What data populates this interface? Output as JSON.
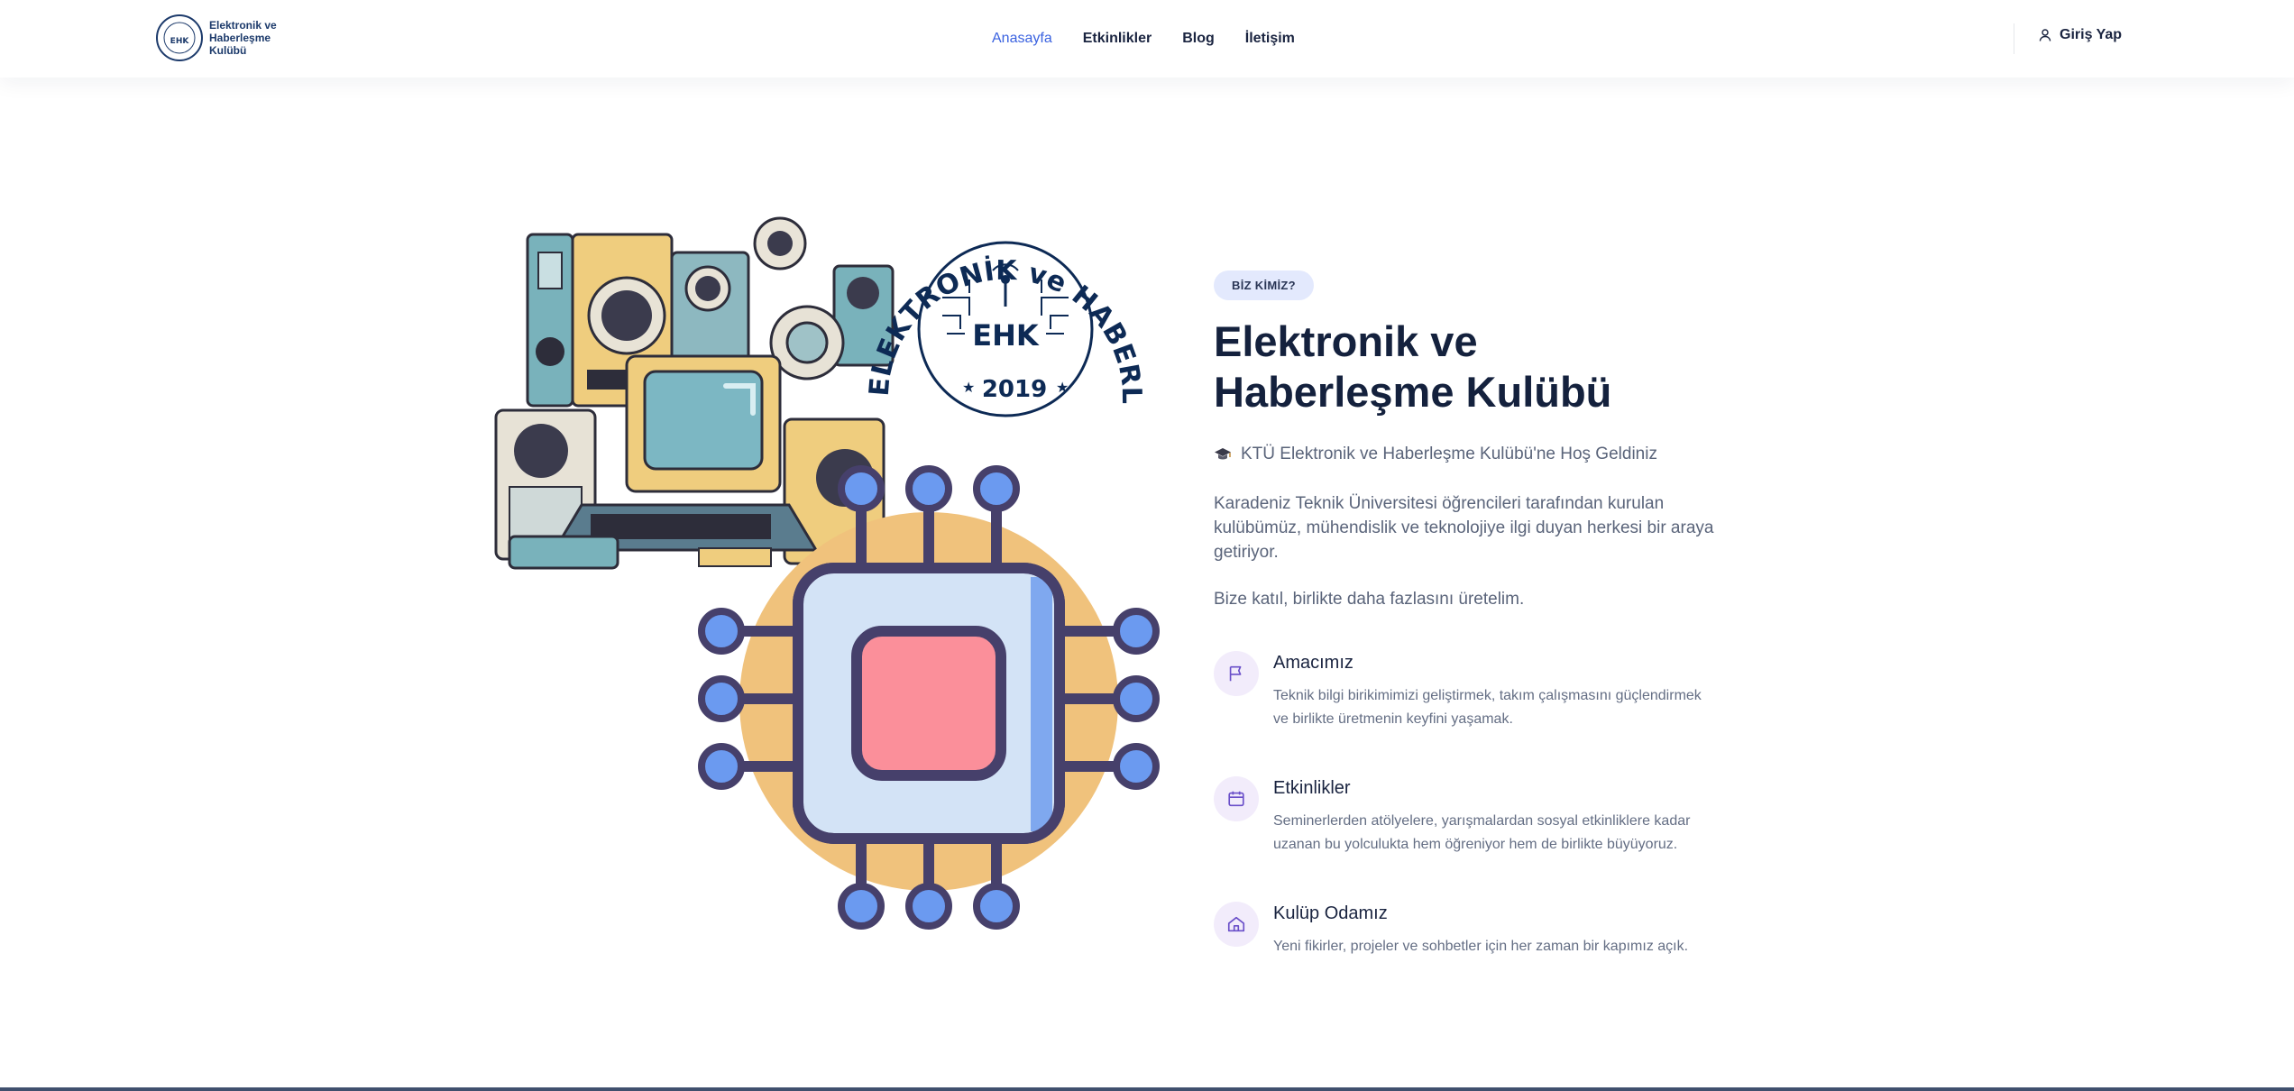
{
  "header": {
    "logo_text": "Elektronik ve Haberleşme Kulübü",
    "nav": [
      {
        "label": "Anasayfa",
        "active": true
      },
      {
        "label": "Etkinlikler",
        "active": false
      },
      {
        "label": "Blog",
        "active": false
      },
      {
        "label": "İletişim",
        "active": false
      }
    ],
    "login_label": "Giriş Yap"
  },
  "seal": {
    "text": "ELEKTRONİK ve HABERLEŞME KULÜBÜ",
    "abbr": "EHK",
    "year": "2019"
  },
  "hero": {
    "badge": "BİZ KİMİZ?",
    "title_line1": "Elektronik ve",
    "title_line2": "Haberleşme Kulübü",
    "welcome": "KTÜ Elektronik ve Haberleşme Kulübü'ne Hoş Geldiniz",
    "paragraph": "Karadeniz Teknik Üniversitesi öğrencileri tarafından kurulan kulübümüz, mühendislik ve teknolojiye ilgi duyan herkesi bir araya getiriyor.",
    "cta": "Bize katıl, birlikte daha fazlasını üretelim."
  },
  "features": [
    {
      "icon": "flag-icon",
      "title": "Amacımız",
      "desc": "Teknik bilgi birikimimizi geliştirmek, takım çalışmasını güçlendirmek ve birlikte üretmenin keyfini yaşamak."
    },
    {
      "icon": "calendar-icon",
      "title": "Etkinlikler",
      "desc": "Seminerlerden atölyelere, yarışmalardan sosyal etkinliklere kadar uzanan bu yolculukta hem öğreniyor hem de birlikte büyüyoruz."
    },
    {
      "icon": "home-icon",
      "title": "Kulüp Odamız",
      "desc": "Yeni fikirler, projeler ve sohbetler için her zaman bir kapımız açık."
    }
  ],
  "colors": {
    "accent": "#3a62e0",
    "heading": "#14213d",
    "chip_orange": "#f0c27c",
    "chip_body": "#d3e3f6",
    "chip_core": "#fb8f9a",
    "chip_outline": "#46406b",
    "pin_fill": "#6b9af0",
    "icon_purple": "#6a4fc9"
  }
}
